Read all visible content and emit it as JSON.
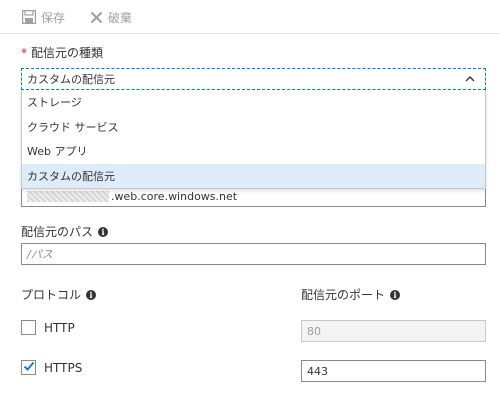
{
  "toolbar": {
    "save_label": "保存",
    "discard_label": "破棄"
  },
  "origin_type": {
    "label": "配信元の種類",
    "required_mark": "*",
    "selected": "カスタムの配信元",
    "options": [
      "ストレージ",
      "クラウド サービス",
      "Web アプリ",
      "カスタムの配信元"
    ],
    "selected_index": 3
  },
  "origin_hostname": {
    "value_suffix": ".web.core.windows.net"
  },
  "origin_path": {
    "label": "配信元のパス",
    "placeholder": "/パス"
  },
  "protocol": {
    "label": "プロトコル",
    "port_label": "配信元のポート",
    "http": {
      "label": "HTTP",
      "checked": false,
      "port": "80"
    },
    "https": {
      "label": "HTTPS",
      "checked": true,
      "port": "443"
    }
  },
  "colors": {
    "accent": "#0078d4",
    "required": "#c1272d",
    "selected_option_bg": "#deecf9"
  },
  "icons": {
    "save": "save-icon",
    "discard": "close-icon",
    "chevron": "chevron-up-icon",
    "info": "info-icon",
    "check": "checkmark-icon"
  }
}
